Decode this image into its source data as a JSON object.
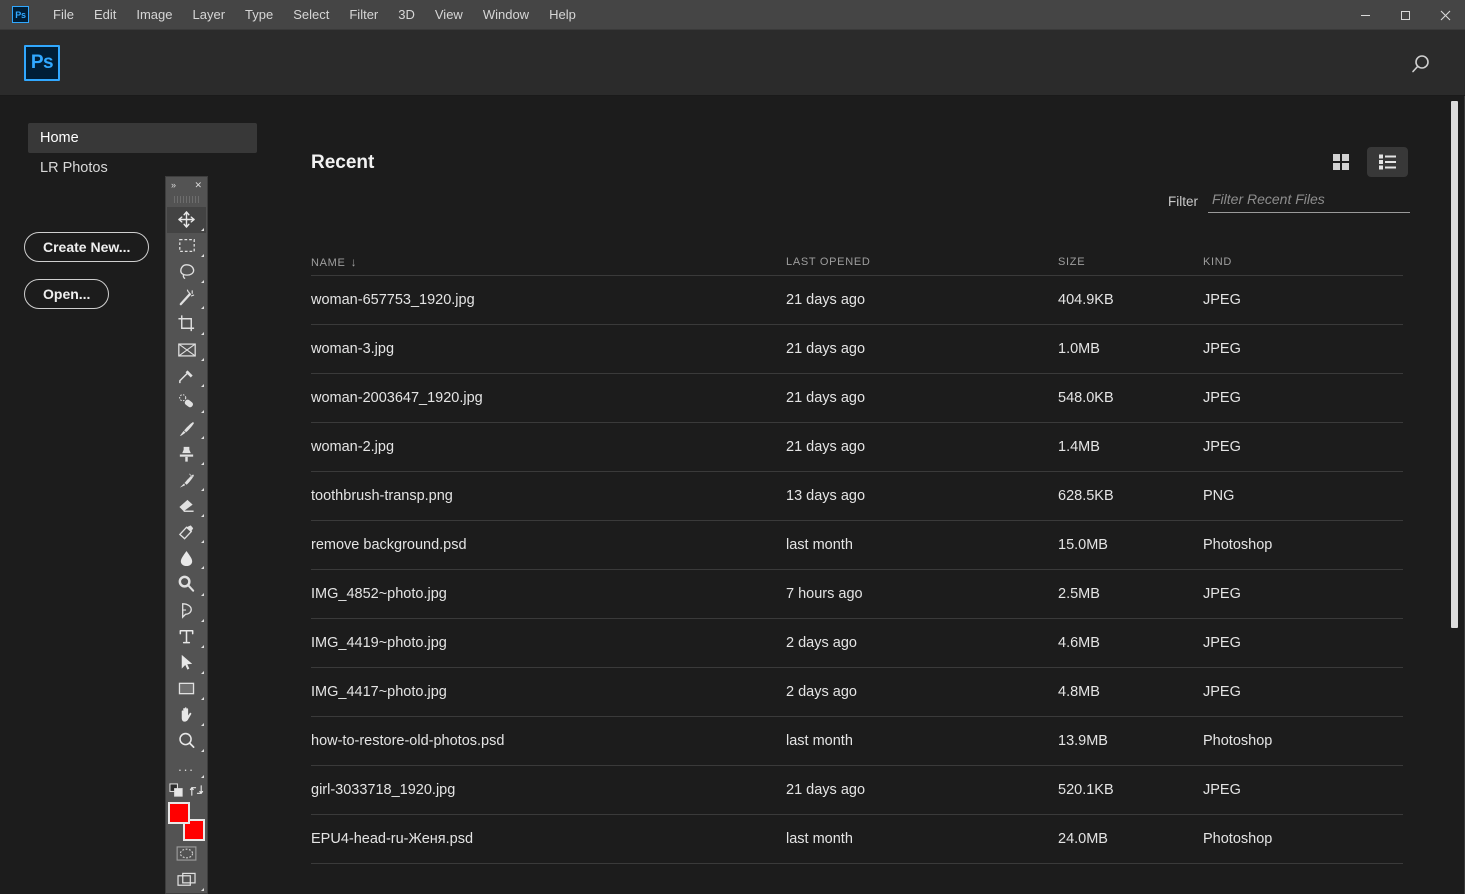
{
  "window": {
    "app_icon": "Ps",
    "controls": [
      {
        "name": "minimize",
        "glyph": "minimize-icon"
      },
      {
        "name": "maximize",
        "glyph": "maximize-icon"
      },
      {
        "name": "close",
        "glyph": "close-icon"
      }
    ]
  },
  "menu": {
    "items": [
      "File",
      "Edit",
      "Image",
      "Layer",
      "Type",
      "Select",
      "Filter",
      "3D",
      "View",
      "Window",
      "Help"
    ]
  },
  "appbar": {
    "logo_text": "Ps",
    "search_icon": "search-icon"
  },
  "sidebar": {
    "items": [
      {
        "label": "Home",
        "active": true
      },
      {
        "label": "LR Photos",
        "active": false
      }
    ],
    "buttons": [
      {
        "label": "Create New..."
      },
      {
        "label": "Open..."
      }
    ]
  },
  "toolbar": {
    "collapse_icon": "double-chevron-right-icon",
    "close_icon": "close-icon",
    "tools": [
      {
        "name": "move-tool",
        "selected": true
      },
      {
        "name": "rectangular-marquee-tool",
        "selected": false
      },
      {
        "name": "lasso-tool",
        "selected": false
      },
      {
        "name": "magic-wand-tool",
        "selected": false
      },
      {
        "name": "crop-tool",
        "selected": false
      },
      {
        "name": "frame-tool",
        "selected": false
      },
      {
        "name": "eyedropper-tool",
        "selected": false
      },
      {
        "name": "healing-brush-tool",
        "selected": false
      },
      {
        "name": "brush-tool",
        "selected": false
      },
      {
        "name": "clone-stamp-tool",
        "selected": false
      },
      {
        "name": "history-brush-tool",
        "selected": false
      },
      {
        "name": "eraser-tool",
        "selected": false
      },
      {
        "name": "gradient-tool",
        "selected": false
      },
      {
        "name": "blur-tool",
        "selected": false
      },
      {
        "name": "dodge-tool",
        "selected": false
      },
      {
        "name": "pen-tool",
        "selected": false
      },
      {
        "name": "horizontal-type-tool",
        "selected": false
      },
      {
        "name": "path-selection-tool",
        "selected": false
      },
      {
        "name": "rectangle-tool",
        "selected": false
      },
      {
        "name": "hand-tool",
        "selected": false
      },
      {
        "name": "zoom-tool",
        "selected": false
      }
    ],
    "more_tools": "...",
    "foreground_color": "#ff0000",
    "background_color": "#ff0000",
    "quick_mask_icon": "quick-mask-icon",
    "screen_mode_icon": "screen-mode-icon"
  },
  "main": {
    "title": "Recent",
    "view_modes": [
      {
        "name": "grid-view",
        "active": false
      },
      {
        "name": "list-view",
        "active": true
      }
    ],
    "filter": {
      "label": "Filter",
      "placeholder": "Filter Recent Files",
      "value": ""
    },
    "table": {
      "columns": [
        "NAME",
        "LAST OPENED",
        "SIZE",
        "KIND"
      ],
      "sort_column": "NAME",
      "sort_direction": "down",
      "sort_glyph": "↓",
      "rows": [
        {
          "name": "woman-657753_1920.jpg",
          "last_opened": "21 days ago",
          "size": "404.9KB",
          "kind": "JPEG"
        },
        {
          "name": "woman-3.jpg",
          "last_opened": "21 days ago",
          "size": "1.0MB",
          "kind": "JPEG"
        },
        {
          "name": "woman-2003647_1920.jpg",
          "last_opened": "21 days ago",
          "size": "548.0KB",
          "kind": "JPEG"
        },
        {
          "name": "woman-2.jpg",
          "last_opened": "21 days ago",
          "size": "1.4MB",
          "kind": "JPEG"
        },
        {
          "name": "toothbrush-transp.png",
          "last_opened": "13 days ago",
          "size": "628.5KB",
          "kind": "PNG"
        },
        {
          "name": "remove background.psd",
          "last_opened": "last month",
          "size": "15.0MB",
          "kind": "Photoshop"
        },
        {
          "name": "IMG_4852~photo.jpg",
          "last_opened": "7 hours ago",
          "size": "2.5MB",
          "kind": "JPEG"
        },
        {
          "name": "IMG_4419~photo.jpg",
          "last_opened": "2 days ago",
          "size": "4.6MB",
          "kind": "JPEG"
        },
        {
          "name": "IMG_4417~photo.jpg",
          "last_opened": "2 days ago",
          "size": "4.8MB",
          "kind": "JPEG"
        },
        {
          "name": "how-to-restore-old-photos.psd",
          "last_opened": "last month",
          "size": "13.9MB",
          "kind": "Photoshop"
        },
        {
          "name": "girl-3033718_1920.jpg",
          "last_opened": "21 days ago",
          "size": "520.1KB",
          "kind": "JPEG"
        },
        {
          "name": "EPU4-head-ru-Женя.psd",
          "last_opened": "last month",
          "size": "24.0MB",
          "kind": "Photoshop"
        }
      ]
    }
  },
  "colors": {
    "accent": "#31a8ff",
    "background": "#1c1c1c",
    "panel": "#535353",
    "menubar": "#454545",
    "appbar": "#2b2b2b",
    "swatch_red": "#ff0000"
  }
}
